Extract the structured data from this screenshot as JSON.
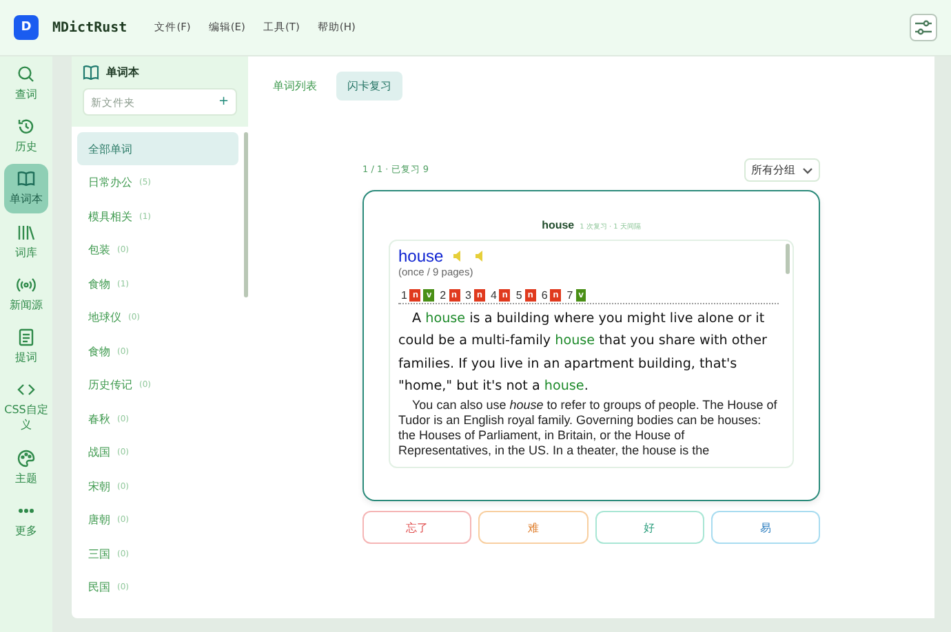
{
  "app": {
    "logo": "D",
    "title": "MDictRust"
  },
  "menu": [
    "文件(F)",
    "编辑(E)",
    "工具(T)",
    "帮助(H)"
  ],
  "nav": [
    {
      "kind": "search",
      "label": "查词",
      "selected": false
    },
    {
      "kind": "history",
      "label": "历史",
      "selected": false
    },
    {
      "kind": "book",
      "label": "单词本",
      "selected": true
    },
    {
      "kind": "library",
      "label": "词库",
      "selected": false
    },
    {
      "kind": "broadcast",
      "label": "新闻源",
      "selected": false
    },
    {
      "kind": "doc",
      "label": "提词",
      "selected": false
    },
    {
      "kind": "code",
      "label": "CSS自定义",
      "selected": false
    },
    {
      "kind": "palette",
      "label": "主题",
      "selected": false
    },
    {
      "kind": "more",
      "label": "更多",
      "selected": false
    }
  ],
  "notebook": {
    "title": "单词本",
    "new_folder": {
      "placeholder": "新文件夹",
      "button": "+"
    },
    "folders": [
      {
        "name": "全部单词",
        "selected": true
      },
      {
        "name": "日常办公",
        "count": "(5)",
        "selected": false
      },
      {
        "name": "模具相关",
        "count": "(1)",
        "selected": false
      },
      {
        "name": "包装",
        "count": "(0)",
        "selected": false
      },
      {
        "name": "食物",
        "count": "(1)",
        "selected": false
      },
      {
        "name": "地球仪",
        "count": "(0)",
        "selected": false
      },
      {
        "name": "食物",
        "count": "(0)",
        "selected": false
      },
      {
        "name": "历史传记",
        "count": "(0)",
        "selected": false
      },
      {
        "name": "春秋",
        "count": "(0)",
        "selected": false
      },
      {
        "name": "战国",
        "count": "(0)",
        "selected": false
      },
      {
        "name": "宋朝",
        "count": "(0)",
        "selected": false
      },
      {
        "name": "唐朝",
        "count": "(0)",
        "selected": false
      },
      {
        "name": "三国",
        "count": "(0)",
        "selected": false
      },
      {
        "name": "民国",
        "count": "(0)",
        "selected": false
      }
    ]
  },
  "tabs": [
    {
      "label": "单词列表",
      "selected": false
    },
    {
      "label": "闪卡复习",
      "selected": true
    }
  ],
  "review": {
    "progress": "1 / 1 · 已复习 9",
    "group_select": "所有分组",
    "card": {
      "word": "house",
      "meta": "1 次复习 · 1 天间隔",
      "entry": {
        "headword": "house",
        "frequency": "(once / 9 pages)",
        "senses": [
          {
            "number": "1",
            "tags": [
              {
                "label": "n",
                "color": "#e03a1e"
              },
              {
                "label": "v",
                "color": "#4a8f16"
              }
            ]
          },
          {
            "number": "2",
            "tags": [
              {
                "label": "n",
                "color": "#e03a1e"
              }
            ]
          },
          {
            "number": "3",
            "tags": [
              {
                "label": "n",
                "color": "#e03a1e"
              }
            ]
          },
          {
            "number": "4",
            "tags": [
              {
                "label": "n",
                "color": "#e03a1e"
              }
            ]
          },
          {
            "number": "5",
            "tags": [
              {
                "label": "n",
                "color": "#e03a1e"
              }
            ]
          },
          {
            "number": "6",
            "tags": [
              {
                "label": "n",
                "color": "#e03a1e"
              }
            ]
          },
          {
            "number": "7",
            "tags": [
              {
                "label": "v",
                "color": "#4a8f16"
              }
            ]
          }
        ],
        "definition": [
          {
            "text": "A ",
            "highlight": false
          },
          {
            "text": "house",
            "highlight": true
          },
          {
            "text": " is a building where you might live alone or it could be a multi-family ",
            "highlight": false
          },
          {
            "text": "house",
            "highlight": true
          },
          {
            "text": " that you share with other families. If you live in an apartment building, that's \"home,\" but it's not a ",
            "highlight": false
          },
          {
            "text": "house",
            "highlight": true
          },
          {
            "text": ".",
            "highlight": false
          }
        ],
        "usage": "You can also use *house* to refer to groups of people. The House of Tudor is an English royal family. Governing bodies can be houses: the Houses of Parliament, in Britain, or the House of Representatives, in the US. In a theater, the house is the"
      }
    },
    "grades": [
      {
        "label": "忘了",
        "kind": "again"
      },
      {
        "label": "难",
        "kind": "hard"
      },
      {
        "label": "好",
        "kind": "good"
      },
      {
        "label": "易",
        "kind": "easy"
      }
    ]
  }
}
